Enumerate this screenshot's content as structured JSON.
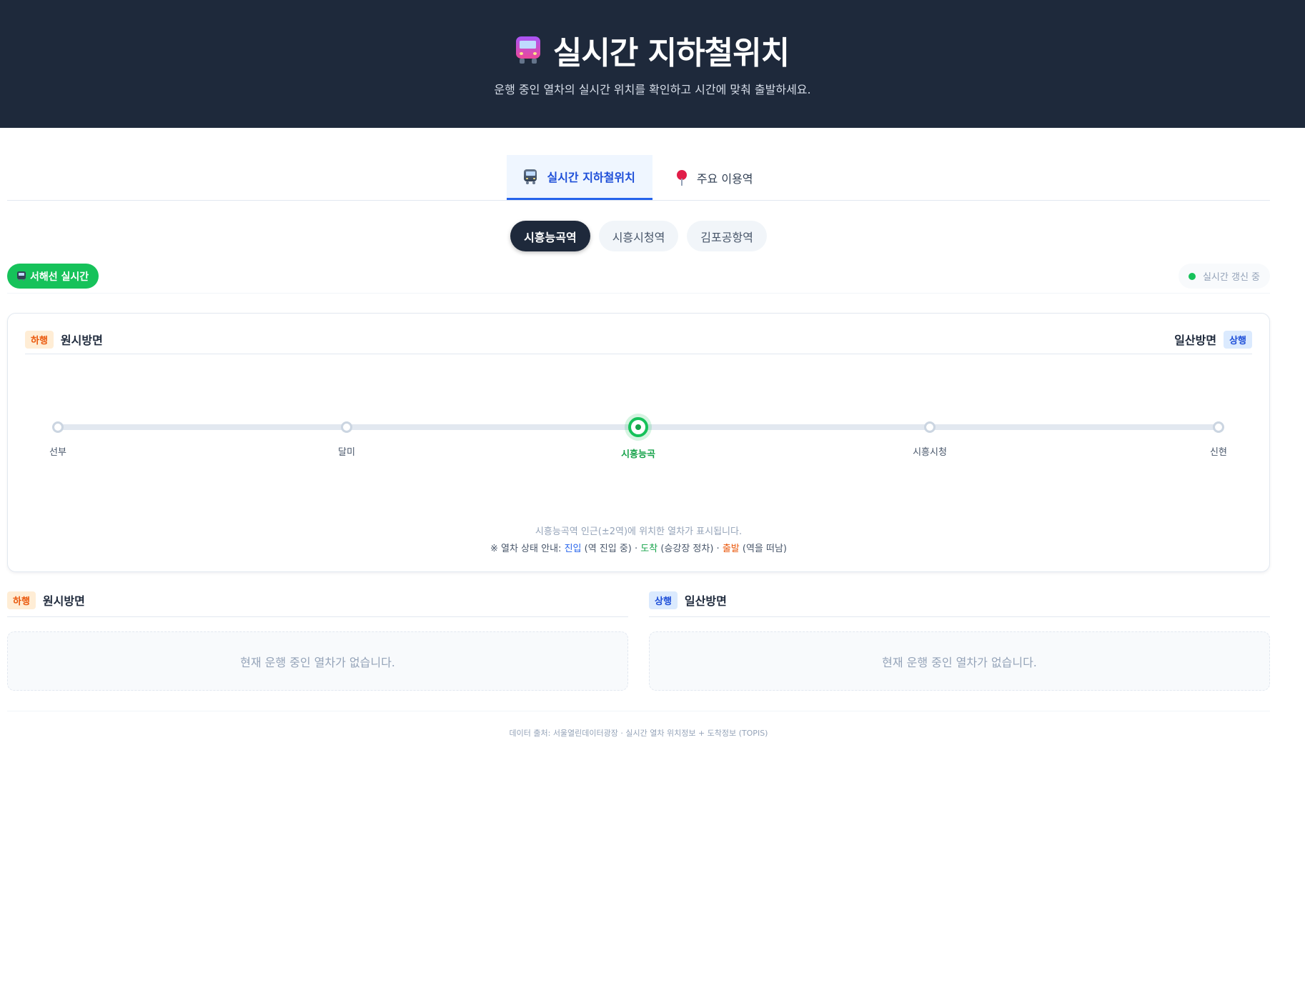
{
  "header": {
    "title": "실시간 지하철위치",
    "subtitle": "운행 중인 열차의 실시간 위치를 확인하고 시간에 맞춰 출발하세요.",
    "icon": "train-icon"
  },
  "tabs": [
    {
      "label": "실시간 지하철위치",
      "icon": "train-icon",
      "active": true
    },
    {
      "label": "주요 이용역",
      "icon": "pin-icon",
      "active": false
    }
  ],
  "stations": [
    {
      "label": "시흥능곡역",
      "active": true
    },
    {
      "label": "시흥시청역",
      "active": false
    },
    {
      "label": "김포공항역",
      "active": false
    }
  ],
  "status": {
    "line_badge": "서해선 실시간",
    "line_color": "#16c25a",
    "live_text": "실시간 갱신 중"
  },
  "map": {
    "left": {
      "tag": "하행",
      "direction": "원시방면"
    },
    "right": {
      "tag": "상행",
      "direction": "일산방면"
    },
    "stops": [
      {
        "name": "선부",
        "current": false
      },
      {
        "name": "달미",
        "current": false
      },
      {
        "name": "시흥능곡",
        "current": true
      },
      {
        "name": "시흥시청",
        "current": false
      },
      {
        "name": "신현",
        "current": false
      }
    ],
    "note": "시흥능곡역 인근(±2역)에 위치한 열차가 표시됩니다.",
    "legend": {
      "prefix": "※ 열차 상태 안내:",
      "enter": "진입",
      "enter_desc": "(역 진입 중) ·",
      "arrive": "도착",
      "arrive_desc": "(승강장 정차) ·",
      "depart": "출발",
      "depart_desc": "(역을 떠남)"
    }
  },
  "columns": {
    "down": {
      "tag": "하행",
      "direction": "원시방면",
      "empty": "현재 운행 중인 열차가 없습니다."
    },
    "up": {
      "tag": "상행",
      "direction": "일산방면",
      "empty": "현재 운행 중인 열차가 없습니다."
    }
  },
  "footer": "데이터 출처: 서울열린데이터광장 · 실시간 열차 위치정보 + 도착정보 (TOPIS)",
  "colors": {
    "header_bg": "#1e293b",
    "accent_blue": "#2563eb",
    "line_green": "#16c25a",
    "down_orange": "#ea580c"
  }
}
